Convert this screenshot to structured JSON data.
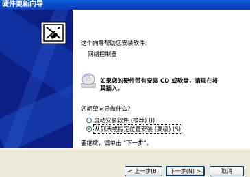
{
  "window": {
    "title": "硬件更新向导"
  },
  "content": {
    "intro": "这个向导帮助您安装软件:",
    "device_name": "网络控制器",
    "cd_prompt_line1": "如果您的硬件带有安装 CD 或软盘，请现在将",
    "cd_prompt_line2": "其插入。",
    "question": "您期望向导做什么?",
    "options": [
      {
        "label": "自动安装软件 (推荐) (I)",
        "selected": false
      },
      {
        "label": "从列表或指定位置安装 (高级) (S)",
        "selected": true
      }
    ],
    "continue_text": "要继续，请单击 \"下一步\"。"
  },
  "buttons": {
    "back": "< 上一步(B)",
    "next": "下一步(N) >",
    "cancel": "取消"
  },
  "icons": {
    "sidebar": "hardware-wizard-icon",
    "cd": "cd-disk-icon"
  },
  "colors": {
    "sidebar": "#0c1f86",
    "titlebar": "#0b47c8",
    "radio_selected": "#21a121"
  }
}
